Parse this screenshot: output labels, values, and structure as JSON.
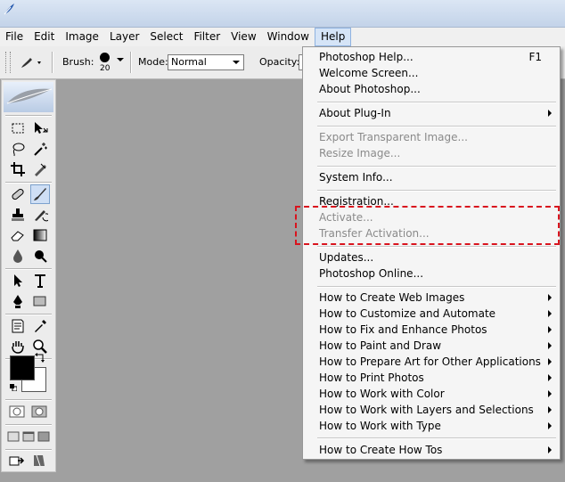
{
  "menubar": [
    "File",
    "Edit",
    "Image",
    "Layer",
    "Select",
    "Filter",
    "View",
    "Window",
    "Help"
  ],
  "active_menu": "Help",
  "options": {
    "brush_label": "Brush:",
    "brush_size": "20",
    "mode_label": "Mode:",
    "mode_value": "Normal",
    "opacity_label": "Opacity:"
  },
  "help_menu": {
    "items": [
      {
        "label": "Photoshop Help...",
        "shortcut": "F1"
      },
      {
        "label": "Welcome Screen..."
      },
      {
        "label": "About Photoshop..."
      },
      {
        "label": "About Plug-In",
        "submenu": true
      },
      {
        "label": "Export Transparent Image...",
        "disabled": true
      },
      {
        "label": "Resize Image...",
        "disabled": true
      },
      {
        "label": "System Info..."
      },
      {
        "label": "Registration..."
      },
      {
        "label": "Activate...",
        "disabled": true
      },
      {
        "label": "Transfer Activation...",
        "disabled": true
      },
      {
        "label": "Updates..."
      },
      {
        "label": "Photoshop Online..."
      },
      {
        "label": "How to Create Web Images",
        "submenu": true
      },
      {
        "label": "How to Customize and Automate",
        "submenu": true
      },
      {
        "label": "How to Fix and Enhance Photos",
        "submenu": true
      },
      {
        "label": "How to Paint and Draw",
        "submenu": true
      },
      {
        "label": "How to Prepare Art for Other Applications",
        "submenu": true
      },
      {
        "label": "How to Print Photos",
        "submenu": true
      },
      {
        "label": "How to Work with Color",
        "submenu": true
      },
      {
        "label": "How to Work with Layers and Selections",
        "submenu": true
      },
      {
        "label": "How to Work with Type",
        "submenu": true
      },
      {
        "label": "How to Create How Tos",
        "submenu": true
      }
    ]
  },
  "colors": {
    "highlight_border": "#d9141e",
    "foreground": "#000000",
    "background": "#ffffff"
  },
  "tools": [
    "marquee-icon",
    "move-icon",
    "lasso-icon",
    "magic-wand-icon",
    "crop-icon",
    "slice-icon",
    "healing-brush-icon",
    "brush-icon",
    "clone-stamp-icon",
    "history-brush-icon",
    "eraser-icon",
    "gradient-icon",
    "blur-icon",
    "dodge-icon",
    "path-select-icon",
    "type-icon",
    "pen-icon",
    "rectangle-icon",
    "notes-icon",
    "eyedropper-icon",
    "hand-icon",
    "zoom-icon"
  ]
}
